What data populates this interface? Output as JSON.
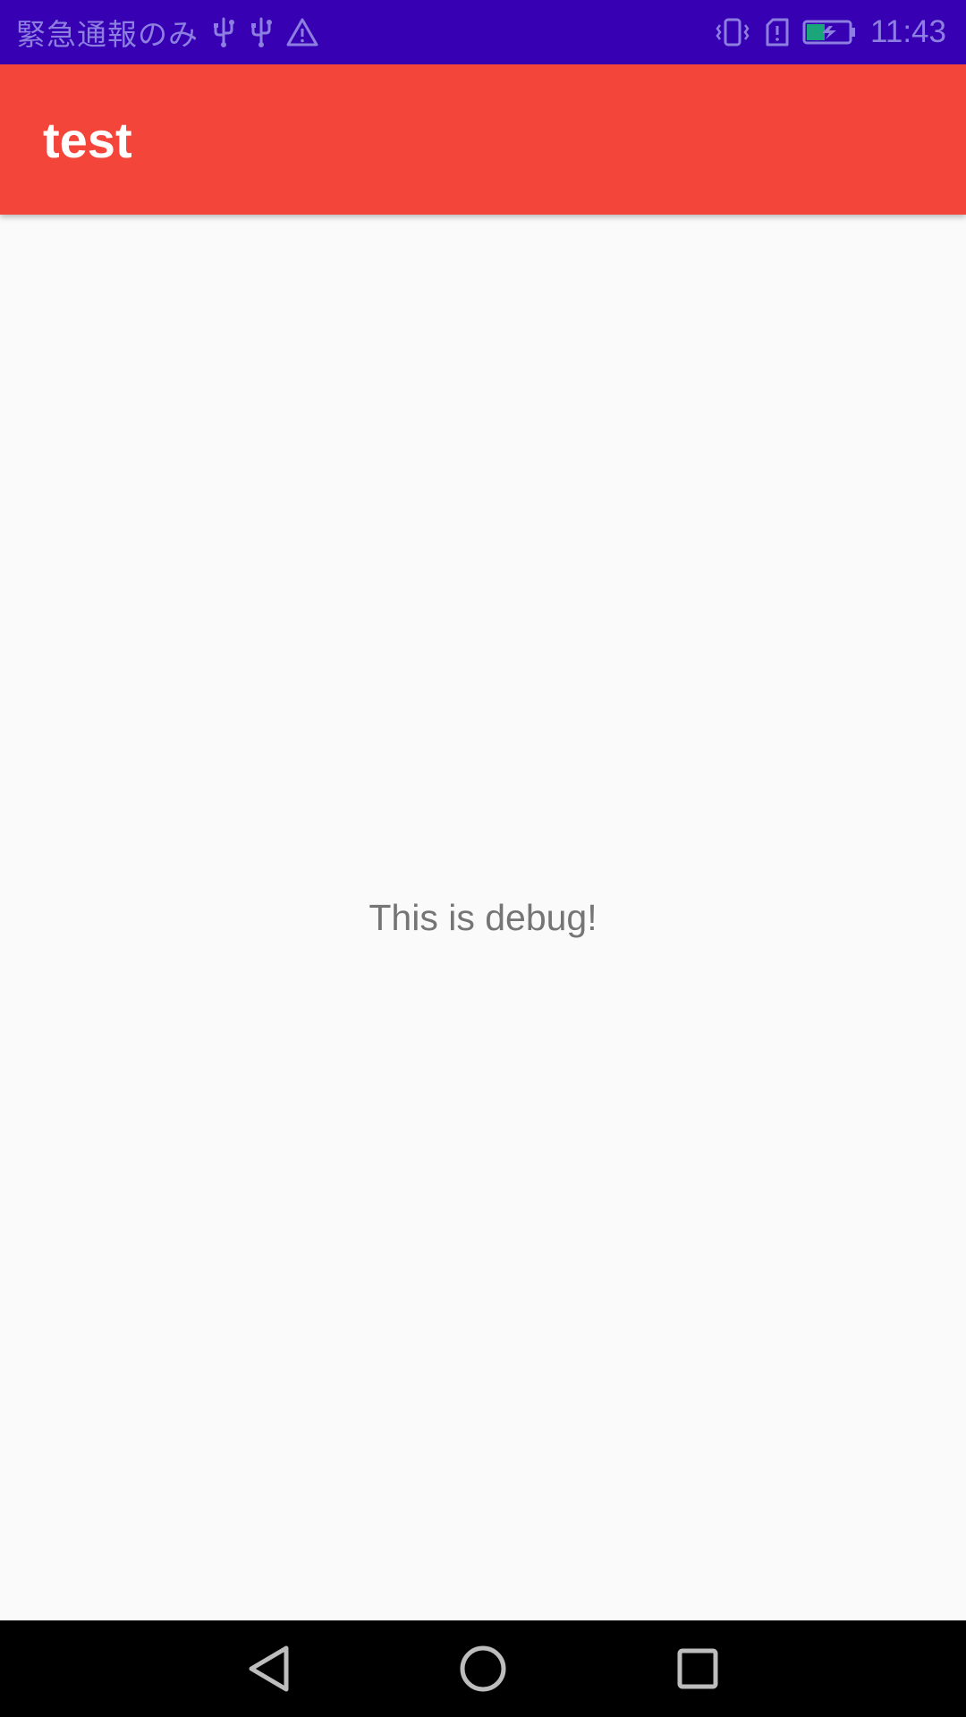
{
  "status_bar": {
    "carrier": "緊急通報のみ",
    "time": "11:43",
    "icons": [
      "usb-icon",
      "usb-icon",
      "warning-icon",
      "vibrate-icon",
      "sim-alert-icon",
      "battery-charging-icon"
    ],
    "background_color": "#3700b3",
    "text_color": "#8c7fe0",
    "battery_fill_color": "#1aa67a"
  },
  "app_bar": {
    "title": "test",
    "background_color": "#f4453a"
  },
  "main": {
    "message": "This is debug!"
  },
  "nav_bar": {
    "buttons": [
      "back-icon",
      "home-icon",
      "recents-icon"
    ]
  }
}
